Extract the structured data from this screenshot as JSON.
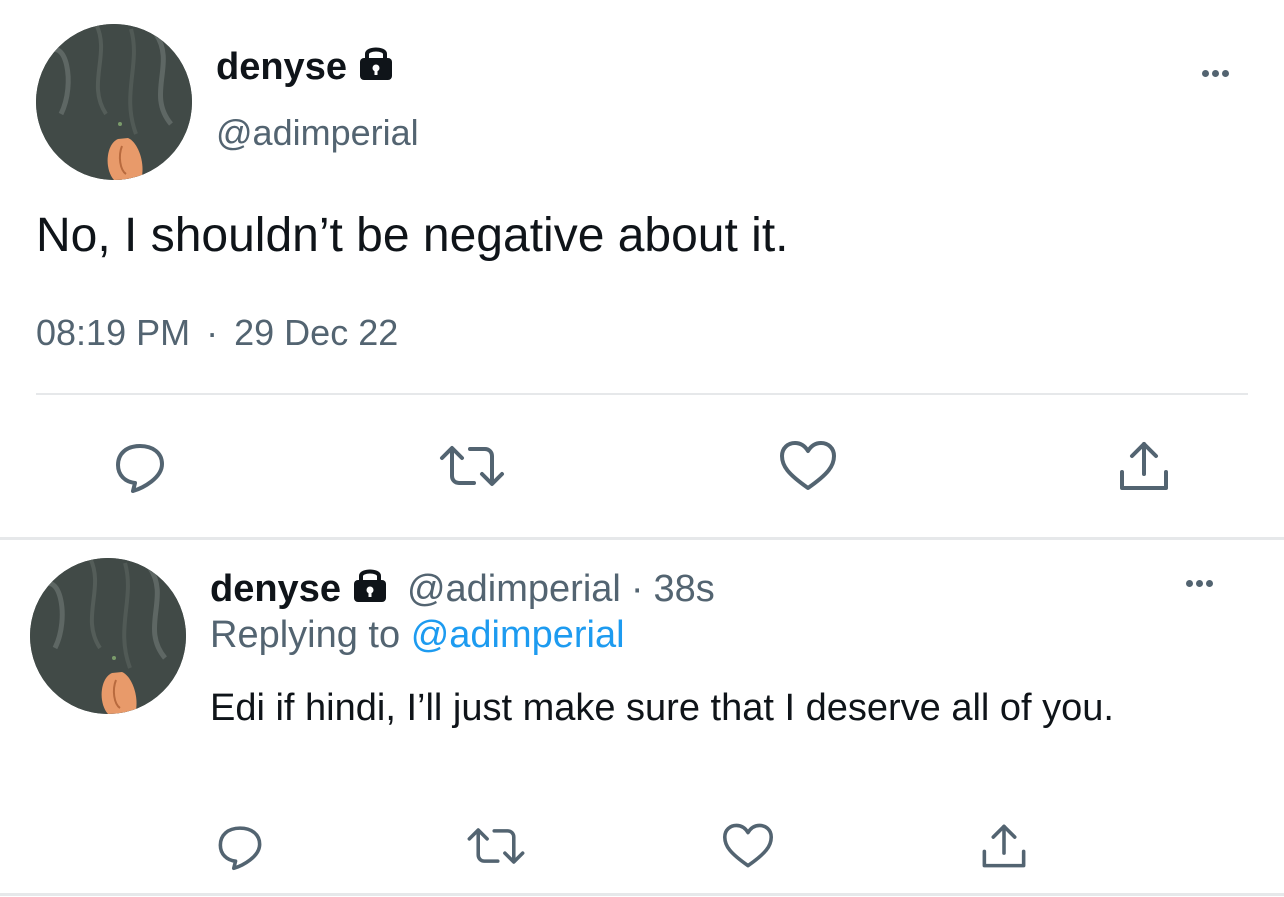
{
  "main_tweet": {
    "author_name": "denyse",
    "author_handle": "@adimperial",
    "protected_icon": "lock-icon",
    "text": "No, I shouldn’t be negative about it.",
    "time": "08:19 PM",
    "separator": "·",
    "date": "29 Dec 22",
    "actions": [
      "reply-icon",
      "retweet-icon",
      "like-icon",
      "share-icon"
    ]
  },
  "reply_tweet": {
    "author_name": "denyse",
    "author_handle": "@adimperial",
    "separator": "·",
    "age": "38s",
    "protected_icon": "lock-icon",
    "replying_label": "Replying to",
    "replying_handle": "@adimperial",
    "text": "Edi if hindi, I’ll just make sure that I deserve all of you.",
    "actions": [
      "reply-icon",
      "retweet-icon",
      "like-icon",
      "share-icon"
    ]
  },
  "colors": {
    "text_primary": "#0f1419",
    "text_secondary": "#536471",
    "link": "#1d9bf0",
    "divider": "#e6e8ea"
  }
}
